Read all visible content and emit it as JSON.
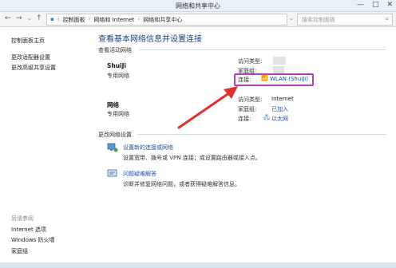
{
  "window": {
    "title": "网络和共享中心",
    "controls": [
      "—",
      "□",
      "✕"
    ]
  },
  "address": {
    "nav_icons": [
      "back-icon",
      "forward-icon",
      "up-icon"
    ],
    "crumbs": [
      "控制面板",
      "网络和 Internet",
      "网络和共享中心"
    ],
    "search_placeholder": "搜索控制面板"
  },
  "sidebar": {
    "items": [
      "控制面板主页",
      "更改适配器设置",
      "更改高级共享设置"
    ],
    "see_also_title": "另请参阅",
    "see_also": [
      "Internet 选项",
      "Windows 防火墙",
      "家庭组"
    ]
  },
  "main": {
    "heading": "查看基本网络信息并设置连接",
    "active_section": "查看活动网络",
    "networks": [
      {
        "name": "ShuiJi",
        "type": "专用网络",
        "access_label": "访问类型:",
        "access_value": "",
        "homegroup_label": "家庭组:",
        "homegroup_value": "",
        "conn_label": "连接:",
        "conn_value": "WLAN (ShuiJi)"
      },
      {
        "name": "网络",
        "type": "专用网络",
        "access_label": "访问类型:",
        "access_value": "Internet",
        "homegroup_label": "家庭组:",
        "homegroup_value": "已加入",
        "conn_label": "连接:",
        "conn_value": "以太网"
      }
    ],
    "change_section": "更改网络设置",
    "tasks": [
      {
        "title": "设置新的连接或网络",
        "desc": "设置宽带、拨号或 VPN 连接；或设置路由器或接入点。"
      },
      {
        "title": "问题疑难解答",
        "desc": "诊断并修复网络问题，或者获得疑难解答信息。"
      }
    ]
  },
  "colors": {
    "link": "#1a52a8",
    "highlight_box": "#b23fb8",
    "arrow": "#e0312c"
  }
}
